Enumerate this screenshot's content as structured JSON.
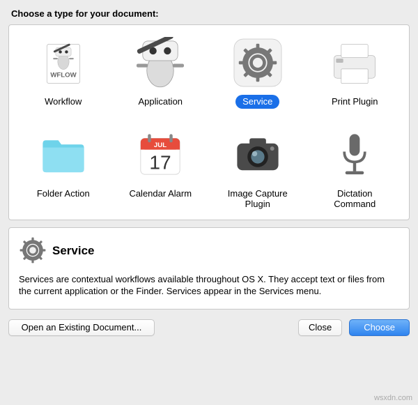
{
  "prompt": "Choose a type for your document:",
  "types": [
    {
      "key": "workflow",
      "label": "Workflow"
    },
    {
      "key": "application",
      "label": "Application"
    },
    {
      "key": "service",
      "label": "Service"
    },
    {
      "key": "print-plugin",
      "label": "Print Plugin"
    },
    {
      "key": "folder-action",
      "label": "Folder Action"
    },
    {
      "key": "calendar-alarm",
      "label": "Calendar Alarm"
    },
    {
      "key": "image-capture-plugin",
      "label": "Image Capture\nPlugin"
    },
    {
      "key": "dictation-command",
      "label": "Dictation\nCommand"
    }
  ],
  "selected_index": 2,
  "description": {
    "title": "Service",
    "body": "Services are contextual workflows available throughout OS X. They accept text or files from the current application or the Finder. Services appear in the Services menu."
  },
  "buttons": {
    "open_existing": "Open an Existing Document...",
    "close": "Close",
    "choose": "Choose"
  },
  "watermark": "wsxdn.com"
}
